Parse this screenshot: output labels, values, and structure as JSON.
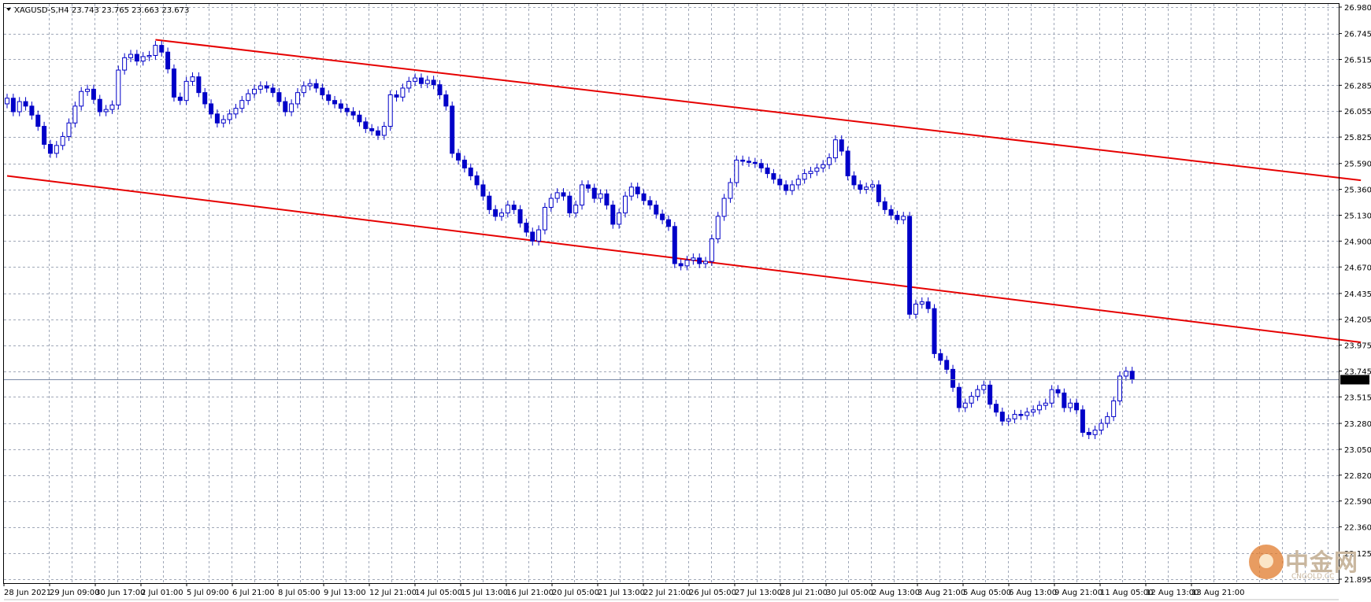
{
  "header": {
    "title": "XAGUSD-S,H4  23.743 23.765 23.663 23.673"
  },
  "price_axis": {
    "ticks": [
      "26.980",
      "26.745",
      "26.515",
      "26.285",
      "26.055",
      "25.825",
      "25.590",
      "25.360",
      "25.130",
      "24.900",
      "24.670",
      "24.435",
      "24.205",
      "23.975",
      "23.745",
      "23.515",
      "23.280",
      "23.050",
      "22.820",
      "22.590",
      "22.360",
      "22.125",
      "21.895"
    ],
    "current_price_label": "23.673"
  },
  "colors": {
    "candle": "#0000c8",
    "trendline": "#e60000",
    "grid": "#a0a8b8",
    "current_price_line": "#7a8aa6",
    "background": "#ffffff"
  },
  "logo": {
    "main_text": "中金网",
    "sub_text": "CNGOLD.CC"
  },
  "chart_data": {
    "type": "candlestick",
    "symbol": "XAGUSD-S",
    "timeframe": "H4",
    "ylim": [
      21.895,
      26.98
    ],
    "x_tick_labels": [
      "28 Jun 2021",
      "29 Jun 09:00",
      "30 Jun 17:00",
      "2 Jul 01:00",
      "5 Jul 09:00",
      "6 Jul 21:00",
      "8 Jul 05:00",
      "9 Jul 13:00",
      "12 Jul 21:00",
      "14 Jul 05:00",
      "15 Jul 13:00",
      "16 Jul 21:00",
      "20 Jul 05:00",
      "21 Jul 13:00",
      "22 Jul 21:00",
      "26 Jul 05:00",
      "27 Jul 13:00",
      "28 Jul 21:00",
      "30 Jul 05:00",
      "2 Aug 13:00",
      "3 Aug 21:00",
      "5 Aug 05:00",
      "6 Aug 13:00",
      "9 Aug 21:00",
      "11 Aug 05:00",
      "12 Aug 13:00",
      "13 Aug 21:00"
    ],
    "closes": [
      26.17,
      26.05,
      26.14,
      26.1,
      26.02,
      25.92,
      25.76,
      25.68,
      25.75,
      25.83,
      25.95,
      26.1,
      26.23,
      26.25,
      26.16,
      26.05,
      26.07,
      26.11,
      26.42,
      26.53,
      26.56,
      26.5,
      26.54,
      26.55,
      26.64,
      26.58,
      26.43,
      26.18,
      26.15,
      26.32,
      26.36,
      26.22,
      26.12,
      26.03,
      25.95,
      25.98,
      26.03,
      26.08,
      26.15,
      26.21,
      26.25,
      26.28,
      26.26,
      26.22,
      26.14,
      26.05,
      26.12,
      26.22,
      26.28,
      26.3,
      26.26,
      26.2,
      26.15,
      26.12,
      26.08,
      26.05,
      26.02,
      25.96,
      25.9,
      25.88,
      25.84,
      25.92,
      26.2,
      26.18,
      26.26,
      26.32,
      26.35,
      26.3,
      26.33,
      26.29,
      26.2,
      26.1,
      25.68,
      25.62,
      25.55,
      25.48,
      25.4,
      25.3,
      25.18,
      25.12,
      25.15,
      25.22,
      25.18,
      25.06,
      24.98,
      24.9,
      25.0,
      25.2,
      25.28,
      25.33,
      25.3,
      25.15,
      25.22,
      25.4,
      25.37,
      25.28,
      25.32,
      25.22,
      25.05,
      25.15,
      25.3,
      25.38,
      25.32,
      25.26,
      25.22,
      25.14,
      25.09,
      25.03,
      24.7,
      24.68,
      24.73,
      24.75,
      24.7,
      24.72,
      24.92,
      25.12,
      25.28,
      25.42,
      25.62,
      25.61,
      25.6,
      25.59,
      25.55,
      25.5,
      25.45,
      25.4,
      25.35,
      25.4,
      25.45,
      25.5,
      25.52,
      25.55,
      25.58,
      25.64,
      25.8,
      25.7,
      25.48,
      25.4,
      25.36,
      25.38,
      25.4,
      25.25,
      25.18,
      25.13,
      25.09,
      25.12,
      24.25,
      24.34,
      24.36,
      24.3,
      23.9,
      23.84,
      23.76,
      23.6,
      23.42,
      23.46,
      23.52,
      23.58,
      23.62,
      23.45,
      23.38,
      23.3,
      23.32,
      23.36,
      23.35,
      23.38,
      23.4,
      23.44,
      23.46,
      23.58,
      23.55,
      23.42,
      23.46,
      23.4,
      23.2,
      23.18,
      23.22,
      23.28,
      23.34,
      23.48,
      23.7,
      23.743,
      23.673
    ],
    "trendlines": [
      {
        "name": "upper-channel-line",
        "from": {
          "bar": 24,
          "price": 26.69
        },
        "to": {
          "bar": 219,
          "price": 25.44
        }
      },
      {
        "name": "lower-channel-line",
        "from": {
          "bar": 0,
          "price": 25.48
        },
        "to": {
          "bar": 219,
          "price": 24.0
        }
      }
    ],
    "current_price": 23.673,
    "grid": true
  }
}
